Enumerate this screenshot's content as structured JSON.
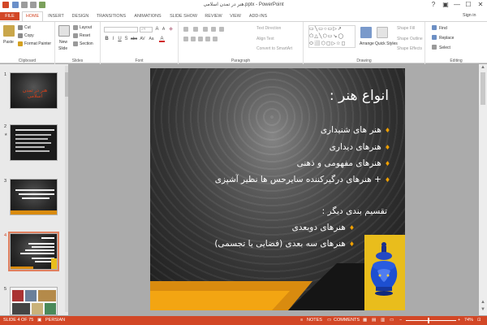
{
  "window": {
    "title": "هنر در تمدن اسلامی.pptx - PowerPoint",
    "controls": [
      "?",
      "▣",
      "—",
      "☐",
      "✕"
    ]
  },
  "tabs": [
    "FILE",
    "HOME",
    "INSERT",
    "DESIGN",
    "TRANSITIONS",
    "ANIMATIONS",
    "SLIDE SHOW",
    "REVIEW",
    "VIEW",
    "ADD-INS"
  ],
  "active_tab": "HOME",
  "sign_in": "Sign in",
  "ribbon": {
    "clipboard": {
      "label": "Clipboard",
      "paste": "Paste",
      "cut": "Cut",
      "copy": "Copy",
      "format_painter": "Format Painter"
    },
    "slides": {
      "label": "Slides",
      "new_slide": "New",
      "new_slide_2": "Slide",
      "layout": "Layout",
      "reset": "Reset",
      "section": "Section"
    },
    "font": {
      "label": "Font",
      "font_name": "",
      "font_size": "24",
      "bold": "B",
      "italic": "I",
      "underline": "U",
      "strike": "S",
      "shadow": "abc",
      "spacing": "AV",
      "case": "Aa",
      "color": "A"
    },
    "paragraph": {
      "label": "Paragraph",
      "text_direction": "Text Direction",
      "align_text": "Align Text",
      "convert_smartart": "Convert to SmartArt"
    },
    "drawing": {
      "label": "Drawing",
      "arrange": "Arrange",
      "quick_styles": "Quick Styles",
      "shape_fill": "Shape Fill",
      "shape_outline": "Shape Outline",
      "shape_effects": "Shape Effects"
    },
    "editing": {
      "label": "Editing",
      "find": "Find",
      "replace": "Replace",
      "select": "Select"
    }
  },
  "slides_panel": [
    {
      "num": "1",
      "star": "",
      "caption": "هنر در تمدن اسلامی",
      "selected": false
    },
    {
      "num": "2",
      "star": "★",
      "caption": "",
      "selected": false
    },
    {
      "num": "3",
      "star": "",
      "caption": "",
      "selected": false
    },
    {
      "num": "4",
      "star": "",
      "caption": "",
      "selected": true
    },
    {
      "num": "5",
      "star": "",
      "caption": "",
      "selected": false
    }
  ],
  "slide": {
    "title": "انواع هنر :",
    "bullets": [
      {
        "mark": "♦",
        "text": "هنر های شنیداری"
      },
      {
        "mark": "♦",
        "text": "هنرهای دیداری"
      },
      {
        "mark": "♦",
        "text": "هنرهای مفهومی و ذهنی"
      },
      {
        "mark": "♦",
        "text": "+ هنرهای درگیرکننده سایرحس ها نظیر آشپزی"
      }
    ],
    "subhead": "تقسیم بندی دیگر :",
    "bullets2": [
      {
        "mark": "♦",
        "text": "هنرهای دوبعدی"
      },
      {
        "mark": "♦",
        "text": "هنرهای سه بعدی (فضایی یا تجسمی)"
      }
    ]
  },
  "status": {
    "slide_info": "SLIDE 4 OF 75",
    "language": "PERSIAN",
    "notes": "NOTES",
    "comments": "COMMENTS",
    "zoom": "74%"
  },
  "colors": {
    "accent": "#d24726",
    "bullet": "#f0a000",
    "gold": "#e9bd1c",
    "blue_glass": "#1d4fd1"
  }
}
